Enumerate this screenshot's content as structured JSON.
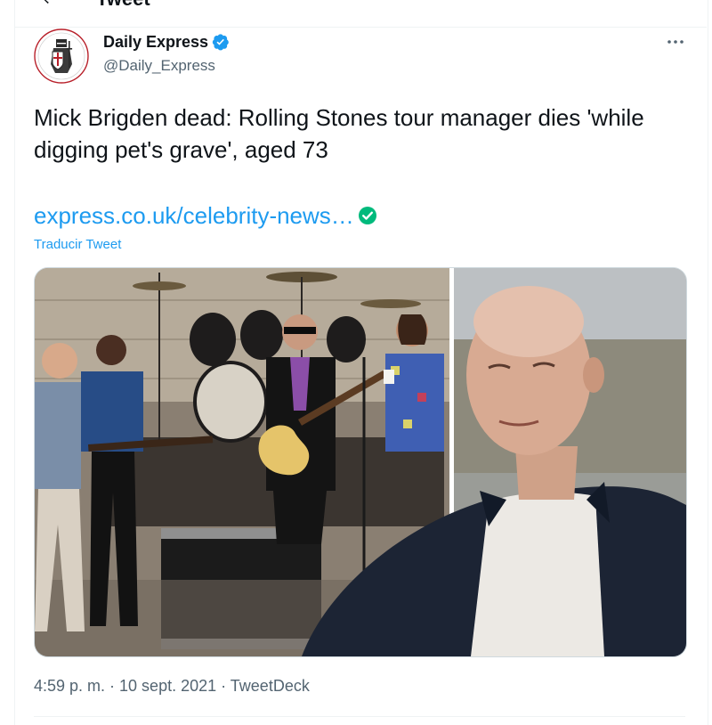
{
  "header": {
    "title": "Tweet",
    "back_icon": "arrow-left-icon"
  },
  "author": {
    "display_name": "Daily Express",
    "handle": "@Daily_Express",
    "verified": true,
    "verified_color": "#1d9bf0"
  },
  "tweet": {
    "text": "Mick Brigden dead: Rolling Stones tour manager dies 'while digging pet's grave', aged 73",
    "link": "express.co.uk/celebrity-news…",
    "link_color": "#1d9bf0",
    "link_check_color": "#00ba7c",
    "translate_label": "Traducir Tweet"
  },
  "media": {
    "left_image": "band-on-stage-photo",
    "right_image": "elderly-man-portrait-photo"
  },
  "meta": {
    "line": "4:59 p. m. · 10 sept. 2021 · TweetDeck"
  }
}
